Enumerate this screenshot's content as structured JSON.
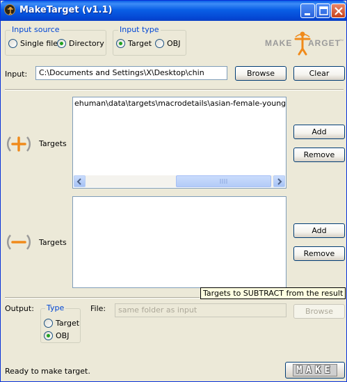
{
  "window": {
    "title": "MakeTarget (v1.1)"
  },
  "logo": {
    "text_pre": "MAKE",
    "text_post": "ARGET",
    "mark": "TM"
  },
  "input_source": {
    "label": "Input source",
    "options": [
      {
        "label": "Single file",
        "selected": false
      },
      {
        "label": "Directory",
        "selected": true
      }
    ]
  },
  "input_type": {
    "label": "Input type",
    "options": [
      {
        "label": "Target",
        "selected": true
      },
      {
        "label": "OBJ",
        "selected": false
      }
    ]
  },
  "input": {
    "label": "Input:",
    "value": "C:\\Documents and Settings\\X\\Desktop\\chin",
    "browse_label": "Browse",
    "clear_label": "Clear"
  },
  "add_targets": {
    "label": "Targets",
    "items": [
      "ehuman\\data\\targets\\macrodetails\\asian-female-young.target"
    ],
    "add_label": "Add",
    "remove_label": "Remove",
    "icon": "plus-circle-icon",
    "accent": "#f08a1a"
  },
  "subtract_targets": {
    "label": "Targets",
    "items": [],
    "add_label": "Add",
    "remove_label": "Remove",
    "icon": "minus-circle-icon",
    "accent": "#f08a1a"
  },
  "tooltip": {
    "text": "Targets to SUBTRACT from the result"
  },
  "output": {
    "label": "Output:",
    "type_group_label": "Type",
    "type_options": [
      {
        "label": "Target",
        "selected": false
      },
      {
        "label": "OBJ",
        "selected": true
      }
    ],
    "file_label": "File:",
    "file_placeholder": "same folder as input",
    "browse_label": "Browse"
  },
  "status": {
    "text": "Ready to make target."
  },
  "make_button": {
    "label": "MAKE"
  }
}
